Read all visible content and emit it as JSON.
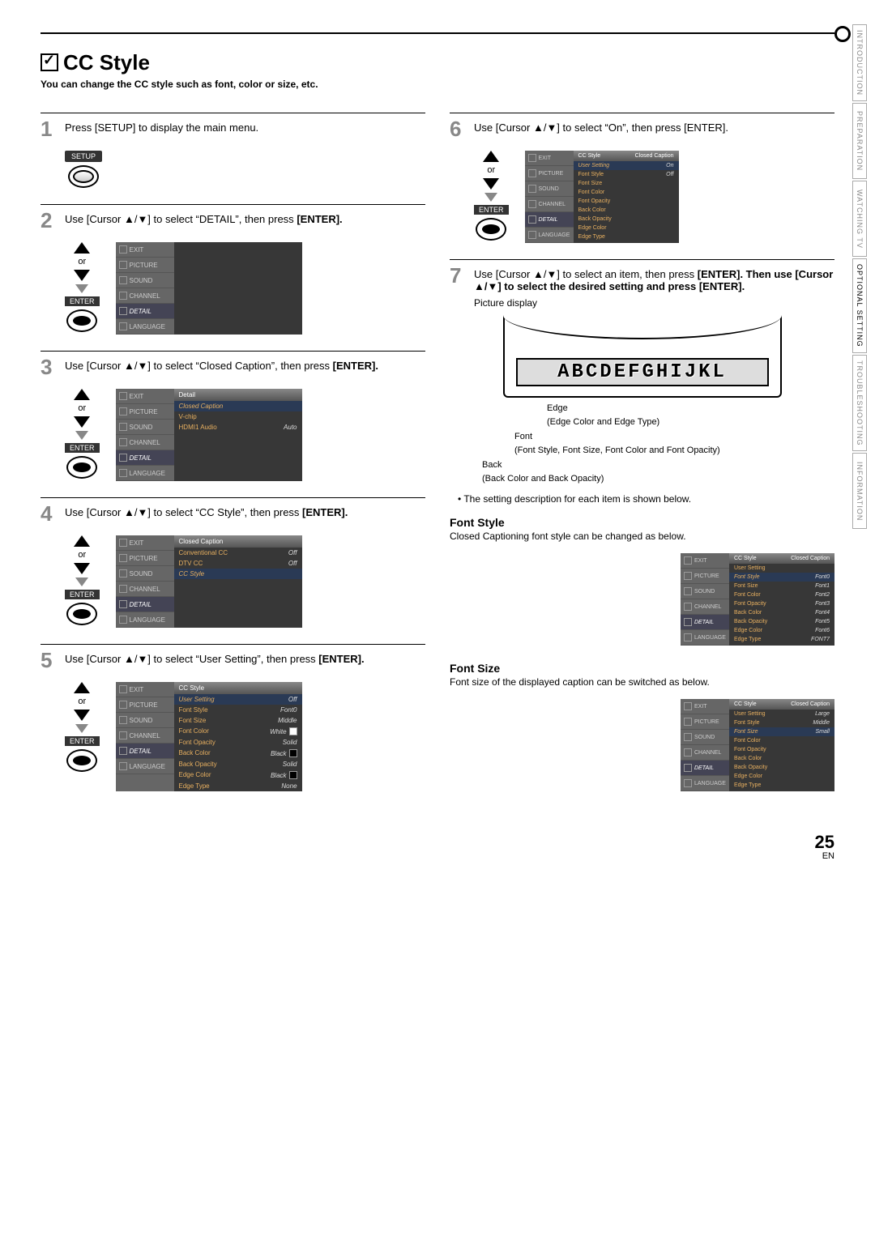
{
  "side_tabs": [
    "INTRODUCTION",
    "PREPARATION",
    "WATCHING TV",
    "OPTIONAL SETTING",
    "TROUBLESHOOTING",
    "INFORMATION"
  ],
  "heading": "CC Style",
  "subtitle": "You can change the CC style such as font, color or size, etc.",
  "steps": {
    "s1": "Press [SETUP] to display the main menu.",
    "s2a": "Use [Cursor ▲/▼] to select “DETAIL”, then press ",
    "s2b": "[ENTER].",
    "s3a": "Use [Cursor ▲/▼] to select “Closed Caption”, then press ",
    "s3b": "[ENTER].",
    "s4a": "Use [Cursor ▲/▼] to select “CC Style”, then press ",
    "s4b": "[ENTER].",
    "s5a": "Use [Cursor ▲/▼] to select “User Setting”, then press ",
    "s5b": "[ENTER].",
    "s6": "Use [Cursor ▲/▼] to select “On”, then press [ENTER].",
    "s7a": "Use [Cursor ▲/▼] to select an item, then press ",
    "s7b": "[ENTER]. Then use [Cursor ▲/▼] to select the desired setting and press [ENTER]."
  },
  "labels": {
    "setup": "SETUP",
    "or": "or",
    "enter": "ENTER",
    "picture_display": "Picture display",
    "cc_sample": "ABCDEFGHIJKL",
    "edge": "Edge",
    "edge_desc": "(Edge Color and Edge Type)",
    "font": "Font",
    "font_desc": "(Font Style, Font Size, Font Color and Font Opacity)",
    "back": "Back",
    "back_desc": "(Back Color and Back Opacity)",
    "bullet": "The setting description for each item is shown below.",
    "fontstyle_h": "Font Style",
    "fontstyle_p": "Closed Captioning font style can be changed as below.",
    "fontsize_h": "Font Size",
    "fontsize_p": "Font size of the displayed caption can be switched as below."
  },
  "menu_side": [
    "EXIT",
    "PICTURE",
    "SOUND",
    "CHANNEL",
    "DETAIL",
    "LANGUAGE"
  ],
  "menu3": {
    "title": "Detail",
    "rows": [
      {
        "k": "Closed Caption",
        "v": "",
        "hl": true
      },
      {
        "k": "V-chip",
        "v": ""
      },
      {
        "k": "HDMI1 Audio",
        "v": "Auto"
      }
    ]
  },
  "menu4": {
    "title": "Closed Caption",
    "rows": [
      {
        "k": "Conventional CC",
        "v": "Off"
      },
      {
        "k": "DTV CC",
        "v": "Off"
      },
      {
        "k": "CC Style",
        "v": "",
        "hl": true
      }
    ]
  },
  "menu5": {
    "title": "CC Style",
    "rows": [
      {
        "k": "User Setting",
        "v": "Off",
        "hl": true
      },
      {
        "k": "Font Style",
        "v": "Font0"
      },
      {
        "k": "Font Size",
        "v": "Middle"
      },
      {
        "k": "Font Color",
        "v": "White",
        "sw": "white"
      },
      {
        "k": "Font Opacity",
        "v": "Solid"
      },
      {
        "k": "Back Color",
        "v": "Black",
        "sw": "black"
      },
      {
        "k": "Back Opacity",
        "v": "Solid"
      },
      {
        "k": "Edge Color",
        "v": "Black",
        "sw": "black"
      },
      {
        "k": "Edge Type",
        "v": "None"
      }
    ]
  },
  "menu6": {
    "title": "CC Style",
    "title_r": "Closed Caption",
    "rows": [
      {
        "k": "User Setting",
        "v": "On",
        "hl": true
      },
      {
        "k": "Font Style",
        "v": "Off"
      },
      {
        "k": "Font Size",
        "v": ""
      },
      {
        "k": "Font Color",
        "v": ""
      },
      {
        "k": "Font Opacity",
        "v": ""
      },
      {
        "k": "Back Color",
        "v": ""
      },
      {
        "k": "Back Opacity",
        "v": ""
      },
      {
        "k": "Edge Color",
        "v": ""
      },
      {
        "k": "Edge Type",
        "v": ""
      }
    ]
  },
  "menu_fs": {
    "title": "CC Style",
    "title_r": "Closed Caption",
    "rows": [
      {
        "k": "User Setting",
        "v": ""
      },
      {
        "k": "Font Style",
        "v": "Font0",
        "hl": true
      },
      {
        "k": "Font Size",
        "v": "Font1"
      },
      {
        "k": "Font Color",
        "v": "Font2"
      },
      {
        "k": "Font Opacity",
        "v": "Font3"
      },
      {
        "k": "Back Color",
        "v": "Font4"
      },
      {
        "k": "Back Opacity",
        "v": "Font5"
      },
      {
        "k": "Edge Color",
        "v": "Font6"
      },
      {
        "k": "Edge Type",
        "v": "FONT7"
      }
    ]
  },
  "menu_sz": {
    "title": "CC Style",
    "title_r": "Closed Caption",
    "rows": [
      {
        "k": "User Setting",
        "v": "Large"
      },
      {
        "k": "Font Style",
        "v": "Middle"
      },
      {
        "k": "Font Size",
        "v": "Small",
        "hl": true
      },
      {
        "k": "Font Color",
        "v": ""
      },
      {
        "k": "Font Opacity",
        "v": ""
      },
      {
        "k": "Back Color",
        "v": ""
      },
      {
        "k": "Back Opacity",
        "v": ""
      },
      {
        "k": "Edge Color",
        "v": ""
      },
      {
        "k": "Edge Type",
        "v": ""
      }
    ]
  },
  "page": "25",
  "lang": "EN"
}
